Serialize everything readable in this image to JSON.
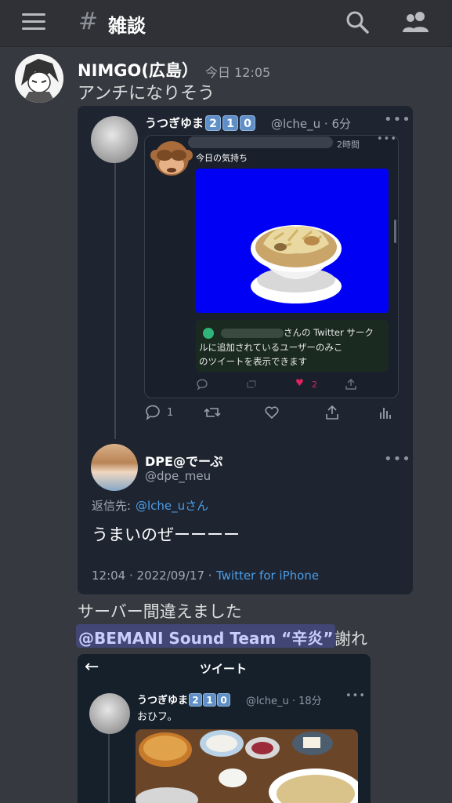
{
  "topbar": {
    "channel_hash": "#",
    "channel_name": "雑談"
  },
  "message": {
    "author": "NIMGO(広島）",
    "timestamp": "今日 12:05",
    "text": "アンチになりそう"
  },
  "embed": {
    "quote": {
      "name": "うつぎゆま",
      "badges": [
        "2",
        "1",
        "0"
      ],
      "handle": "@lche_u · 6分",
      "inner": {
        "time": "2時間",
        "text": "今日の気持ち",
        "circle_notice_line1": "さんの Twitter サーク",
        "circle_notice_line2": "ルに追加されているユーザーのみこ",
        "circle_notice_line3": "のツイートを表示できます",
        "likes": "2"
      },
      "replies": "1"
    },
    "reply": {
      "name": "DPE@でーぷ",
      "handle": "@dpe_meu",
      "reply_to_label": "返信先:",
      "reply_to": "@lche_uさん",
      "text": "うまいのぜーーーー",
      "meta": "12:04 · 2022/09/17 ·",
      "source": "Twitter for iPhone"
    }
  },
  "message2": {
    "line1": "サーバー間違えました",
    "mention": "@BEMANI Sound Team “辛炎”",
    "after_mention": "謝れ"
  },
  "screenshot": {
    "title": "ツイート",
    "name": "うつぎゆま",
    "badges": [
      "2",
      "1",
      "0"
    ],
    "handle": "@lche_u · 18分",
    "text": "おひフ。"
  },
  "colors": {
    "background": "#36393f",
    "topbar": "#2f3136",
    "embed": "#1e2430",
    "link": "#4a9ee8",
    "mention_bg": "#414675",
    "like": "#e0245e"
  }
}
